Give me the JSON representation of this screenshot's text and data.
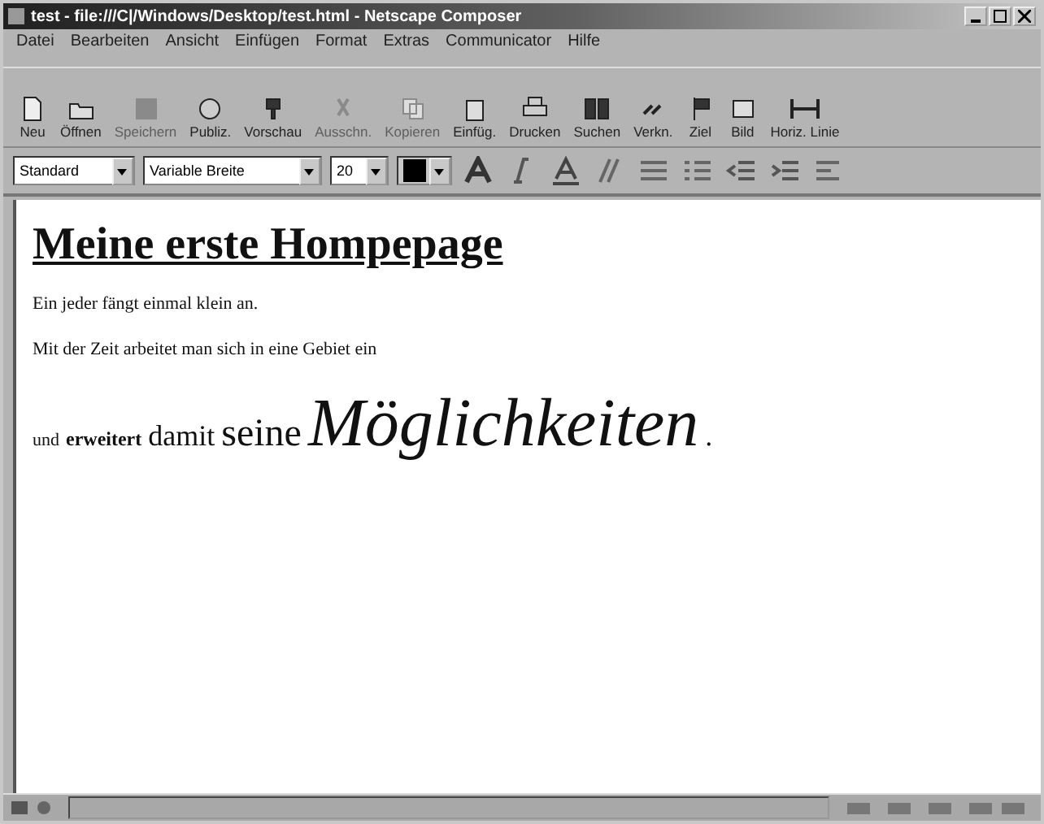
{
  "window": {
    "title": "test - file:///C|/Windows/Desktop/test.html - Netscape Composer"
  },
  "menu": [
    "Datei",
    "Bearbeiten",
    "Ansicht",
    "Einfügen",
    "Format",
    "Extras",
    "Communicator",
    "Hilfe"
  ],
  "toolbar": [
    {
      "label": "Neu",
      "disabled": false
    },
    {
      "label": "Öffnen",
      "disabled": false
    },
    {
      "label": "Speichern",
      "disabled": true
    },
    {
      "label": "Publiz.",
      "disabled": false
    },
    {
      "label": "Vorschau",
      "disabled": false
    },
    {
      "label": "Ausschn.",
      "disabled": true
    },
    {
      "label": "Kopieren",
      "disabled": true
    },
    {
      "label": "Einfüg.",
      "disabled": false
    },
    {
      "label": "Drucken",
      "disabled": false
    },
    {
      "label": "Suchen",
      "disabled": false
    },
    {
      "label": "Verkn.",
      "disabled": false
    },
    {
      "label": "Ziel",
      "disabled": false
    },
    {
      "label": "Bild",
      "disabled": false
    },
    {
      "label": "Horiz. Linie",
      "disabled": false
    }
  ],
  "format_bar": {
    "paragraph": "Standard",
    "font": "Variable Breite",
    "size": "20",
    "color": "#000000"
  },
  "document": {
    "heading": "Meine erste Hompepage",
    "paragraphs": [
      [
        {
          "text": "Ein jeder fängt einmal klein an.",
          "kind": "small"
        }
      ],
      [
        {
          "text": "Mit der Zeit arbeitet man sich in eine Gebiet ein",
          "kind": "small"
        }
      ],
      [
        {
          "text": "und",
          "kind": "small"
        },
        {
          "text": "erweitert",
          "kind": "bold"
        },
        {
          "text": "damit",
          "kind": "medium"
        },
        {
          "text": "seine",
          "kind": "large"
        },
        {
          "text": "Möglichkeiten",
          "kind": "italic"
        },
        {
          "text": ".",
          "kind": "medium"
        }
      ]
    ]
  }
}
